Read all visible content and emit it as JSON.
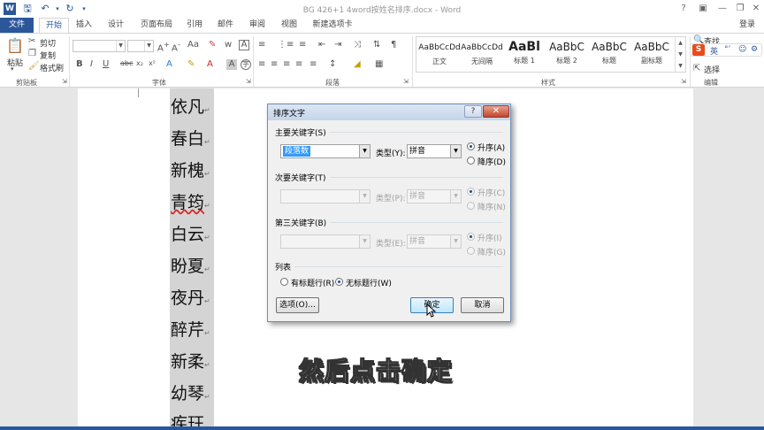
{
  "titlebar": {
    "title": "BG 426+1 4word按姓名排序.docx - Word"
  },
  "tabs": [
    "文件",
    "开始",
    "插入",
    "设计",
    "页面布局",
    "引用",
    "邮件",
    "审阅",
    "视图",
    "新建选项卡"
  ],
  "login": "登录",
  "ribbon": {
    "clipboard": {
      "paste": "粘贴",
      "cut": "剪切",
      "copy": "复制",
      "format_painter": "格式刷",
      "label": "剪贴板"
    },
    "font": {
      "label": "字体"
    },
    "paragraph": {
      "label": "段落"
    },
    "styles": {
      "label": "样式",
      "items": [
        {
          "preview": "AaBbCcDd",
          "name": "正文"
        },
        {
          "preview": "AaBbCcDd",
          "name": "无间隔"
        },
        {
          "preview": "AaBl",
          "name": "标题 1"
        },
        {
          "preview": "AaBbC",
          "name": "标题 2"
        },
        {
          "preview": "AaBbC",
          "name": "标题"
        },
        {
          "preview": "AaBbC",
          "name": "副标题"
        }
      ]
    },
    "editing": {
      "find": "查找",
      "select": "选择",
      "label": "编辑"
    }
  },
  "ime": {
    "lang": "英"
  },
  "document": {
    "names": [
      "依凡",
      "春白",
      "新槐",
      "青筠",
      "白云",
      "盼夏",
      "夜丹",
      "醉芹",
      "新柔",
      "幼琴",
      "疾玨"
    ]
  },
  "dialog": {
    "title": "排序文字",
    "help": "?",
    "primary_key": {
      "label": "主要关键字(S)",
      "field": "段落数",
      "type_label": "类型(Y):",
      "type_value": "拼音",
      "asc": "升序(A)",
      "desc": "降序(D)"
    },
    "secondary_key": {
      "label": "次要关键字(T)",
      "type_label": "类型(P):",
      "type_value": "拼音",
      "asc": "升序(C)",
      "desc": "降序(N)"
    },
    "third_key": {
      "label": "第三关键字(B)",
      "type_label": "类型(E):",
      "type_value": "拼音",
      "asc": "升序(I)",
      "desc": "降序(G)"
    },
    "list": {
      "label": "列表",
      "has_header": "有标题行(R)",
      "no_header": "无标题行(W)"
    },
    "buttons": {
      "options": "选项(O)...",
      "ok": "确定",
      "cancel": "取消"
    }
  },
  "subtitle": "然后点击确定",
  "colors": {
    "accent": "#2b579a",
    "selection": "#d4d4d4"
  }
}
